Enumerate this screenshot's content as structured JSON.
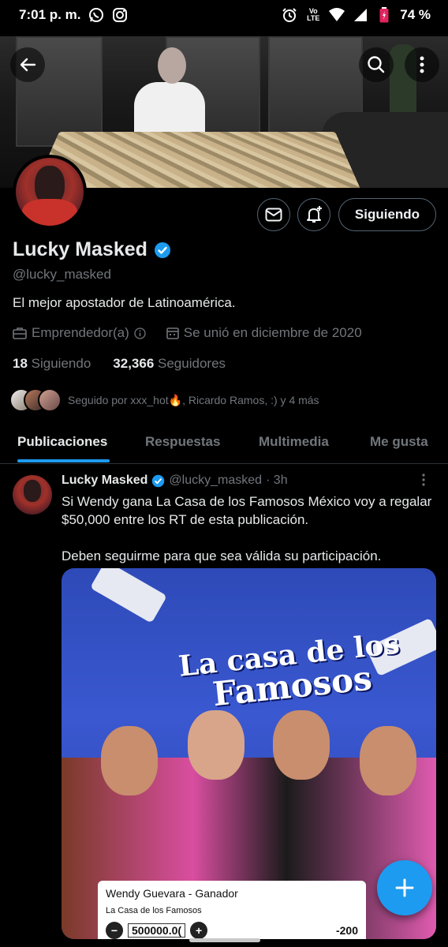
{
  "status_bar": {
    "time": "7:01 p. m.",
    "volte_top": "Vo",
    "volte_bottom": "LTE",
    "battery": "74 %",
    "icons": [
      "whatsapp-icon",
      "instagram-icon",
      "alarm-icon",
      "wifi-icon",
      "signal-icon",
      "battery-icon"
    ]
  },
  "profile": {
    "name": "Lucky Masked",
    "handle": "@lucky_masked",
    "bio": "El mejor apostador de Latinoamérica.",
    "category": "Emprendedor(a)",
    "joined": "Se unió en diciembre de 2020",
    "following_count": "18",
    "following_label": "Siguiendo",
    "followers_count": "32,366",
    "followers_label": "Seguidores",
    "followed_by": "Seguido por xxx_hot🔥, Ricardo Ramos, :) y 4 más",
    "follow_button": "Siguiendo",
    "verified_color": "#1d9bf0"
  },
  "tabs": [
    {
      "label": "Publicaciones",
      "active": true
    },
    {
      "label": "Respuestas",
      "active": false
    },
    {
      "label": "Multimedia",
      "active": false
    },
    {
      "label": "Me gusta",
      "active": false
    }
  ],
  "tweet": {
    "name": "Lucky Masked",
    "handle": "@lucky_masked",
    "time": "· 3h",
    "text_line1": "Si Wendy gana La Casa de los Famosos México voy a regalar $50,000 entre los RT de esta publicación.",
    "text_line2": "Deben seguirme para que sea válida su participación.",
    "media": {
      "logo_line1": "La casa de los",
      "logo_line2": "Famosos",
      "bet_title": "Wendy Guevara - Ganador",
      "bet_subtitle": "La Casa de los Famosos",
      "bet_amount": "500000.0(",
      "bet_minus": "−",
      "bet_plus": "+",
      "bet_odds": "-200"
    }
  },
  "fab_label": "+",
  "accent_color": "#1d9bf0"
}
